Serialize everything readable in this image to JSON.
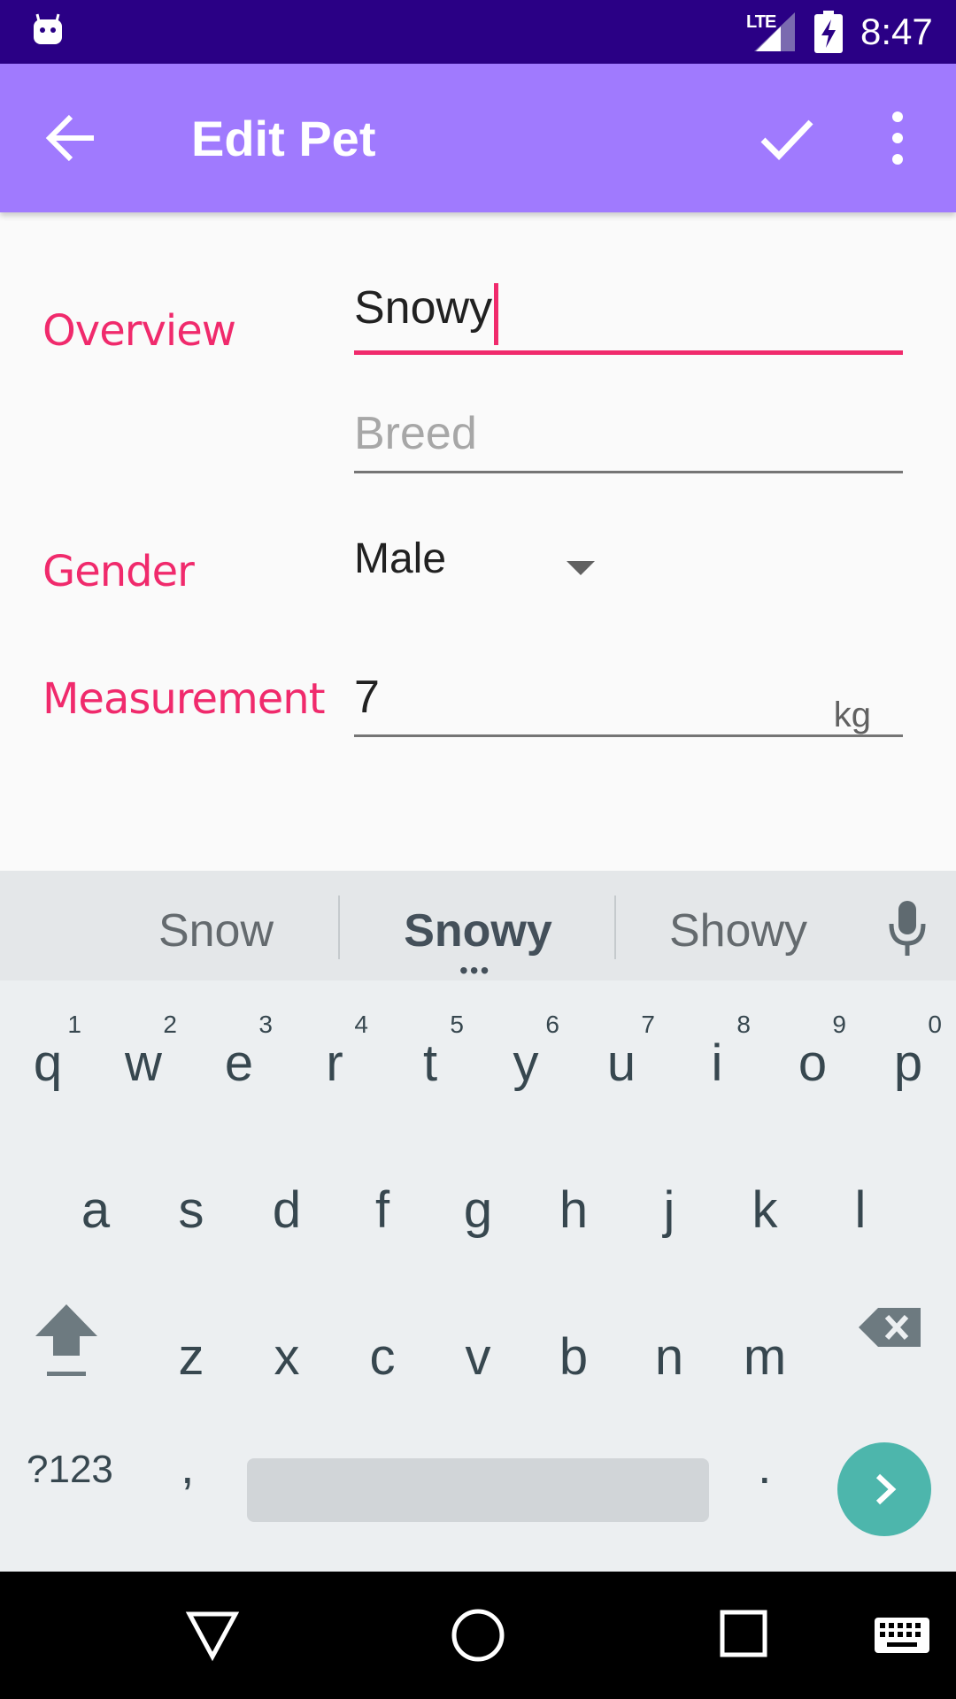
{
  "status_bar": {
    "network": "LTE",
    "time": "8:47"
  },
  "app_bar": {
    "title": "Edit Pet",
    "back_icon": "arrow-back-icon",
    "save_icon": "check-icon",
    "overflow_icon": "more-vert-icon"
  },
  "form": {
    "overview_label": "Overview",
    "name_value": "Snowy",
    "breed_placeholder": "Breed",
    "gender_label": "Gender",
    "gender_value": "Male",
    "measurement_label": "Measurement",
    "weight_value": "7",
    "weight_unit": "kg"
  },
  "keyboard": {
    "suggestions": [
      "Snow",
      "Snowy",
      "Showy"
    ],
    "row1": [
      {
        "ch": "q",
        "num": "1"
      },
      {
        "ch": "w",
        "num": "2"
      },
      {
        "ch": "e",
        "num": "3"
      },
      {
        "ch": "r",
        "num": "4"
      },
      {
        "ch": "t",
        "num": "5"
      },
      {
        "ch": "y",
        "num": "6"
      },
      {
        "ch": "u",
        "num": "7"
      },
      {
        "ch": "i",
        "num": "8"
      },
      {
        "ch": "o",
        "num": "9"
      },
      {
        "ch": "p",
        "num": "0"
      }
    ],
    "row2": [
      "a",
      "s",
      "d",
      "f",
      "g",
      "h",
      "j",
      "k",
      "l"
    ],
    "row3": [
      "z",
      "x",
      "c",
      "v",
      "b",
      "n",
      "m"
    ],
    "symbols_label": "?123",
    "comma": ",",
    "period": "."
  },
  "colors": {
    "status_bar": "#2a0085",
    "app_bar": "#a07afe",
    "accent": "#f02a6c",
    "go_key": "#4db6ac"
  }
}
